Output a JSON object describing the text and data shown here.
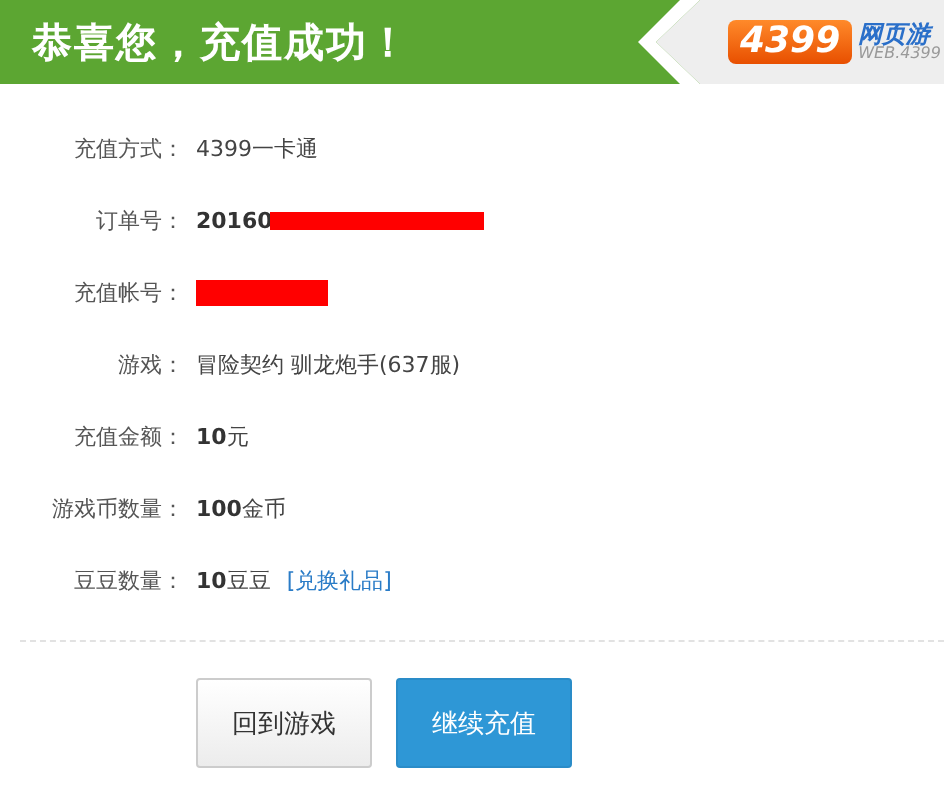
{
  "header": {
    "title": "恭喜您，充值成功！",
    "logo": {
      "badge": "4399",
      "name": "网页游",
      "sub": "WEB.4399"
    }
  },
  "rows": [
    {
      "label": "充值方式：",
      "value": "4399一卡通"
    },
    {
      "label": "订单号：",
      "value": "**20160**",
      "redacted": true
    },
    {
      "label": "充值帐号：",
      "value": "",
      "redacted": true
    },
    {
      "label": "游戏：",
      "value": "冒险契约 驯龙炮手(637服)"
    },
    {
      "label": "充值金额：",
      "value": "**10**元"
    },
    {
      "label": "游戏币数量：",
      "value": "**100**金币"
    },
    {
      "label": "豆豆数量：",
      "value": "**10**豆豆",
      "link": "[兑换礼品]"
    }
  ],
  "buttons": [
    {
      "label": "回到游戏",
      "kind": "secondary"
    },
    {
      "label": "继续充值",
      "kind": "primary"
    }
  ]
}
